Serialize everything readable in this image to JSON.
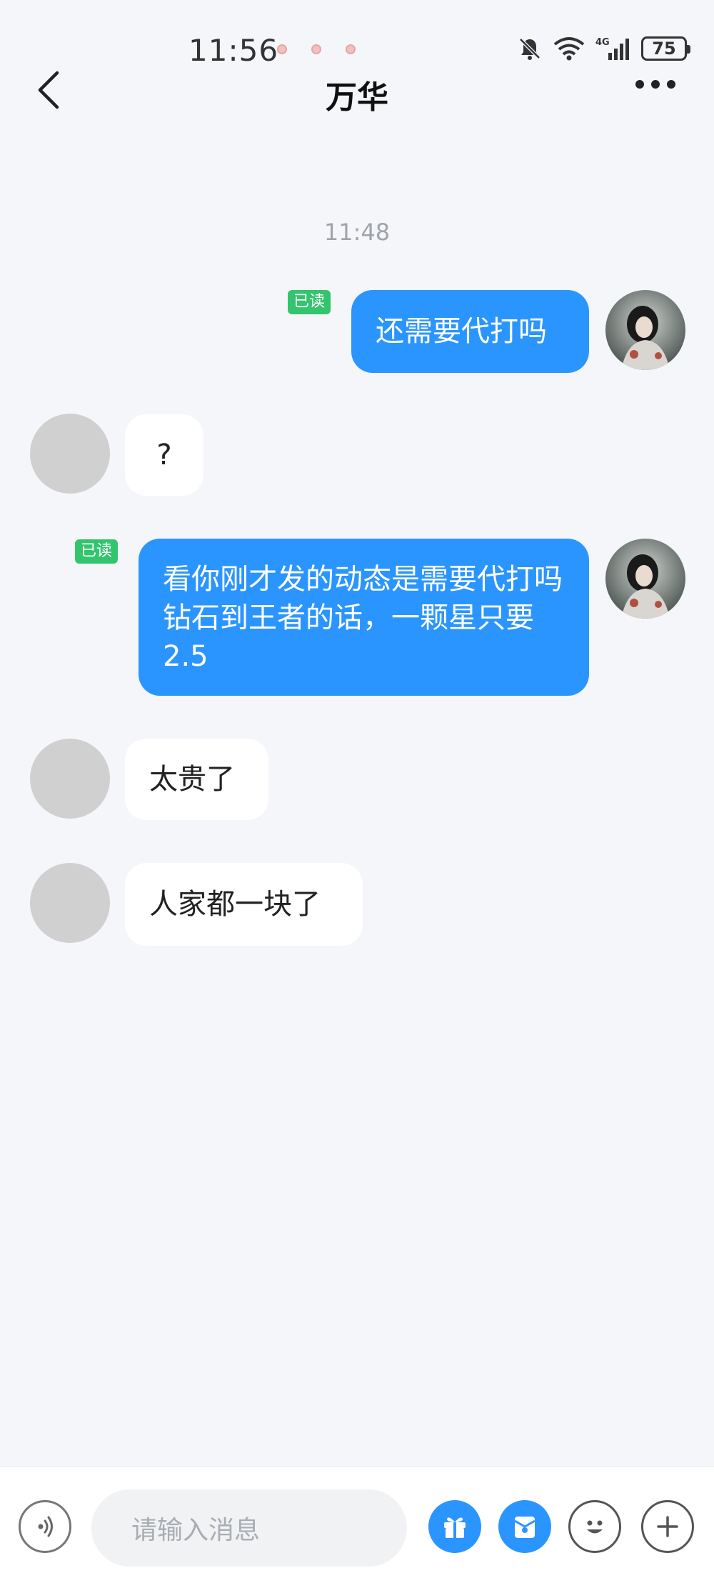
{
  "status_bar": {
    "time": "11:56",
    "battery": "75"
  },
  "header": {
    "title": "万华"
  },
  "conversation": {
    "timestamp": "11:48",
    "messages": [
      {
        "from": "me",
        "text": "还需要代打吗",
        "read_label": "已读"
      },
      {
        "from": "peer",
        "text": "?"
      },
      {
        "from": "me",
        "text": "看你刚才发的动态是需要代打吗 钻石到王者的话，一颗星只要2.5",
        "read_label": "已读"
      },
      {
        "from": "peer",
        "text": "太贵了"
      },
      {
        "from": "peer",
        "text": "人家都一块了"
      }
    ]
  },
  "input_bar": {
    "placeholder": "请输入消息"
  },
  "colors": {
    "accent": "#2b95ff",
    "read_badge": "#33c46e",
    "background": "#f4f6f9"
  }
}
